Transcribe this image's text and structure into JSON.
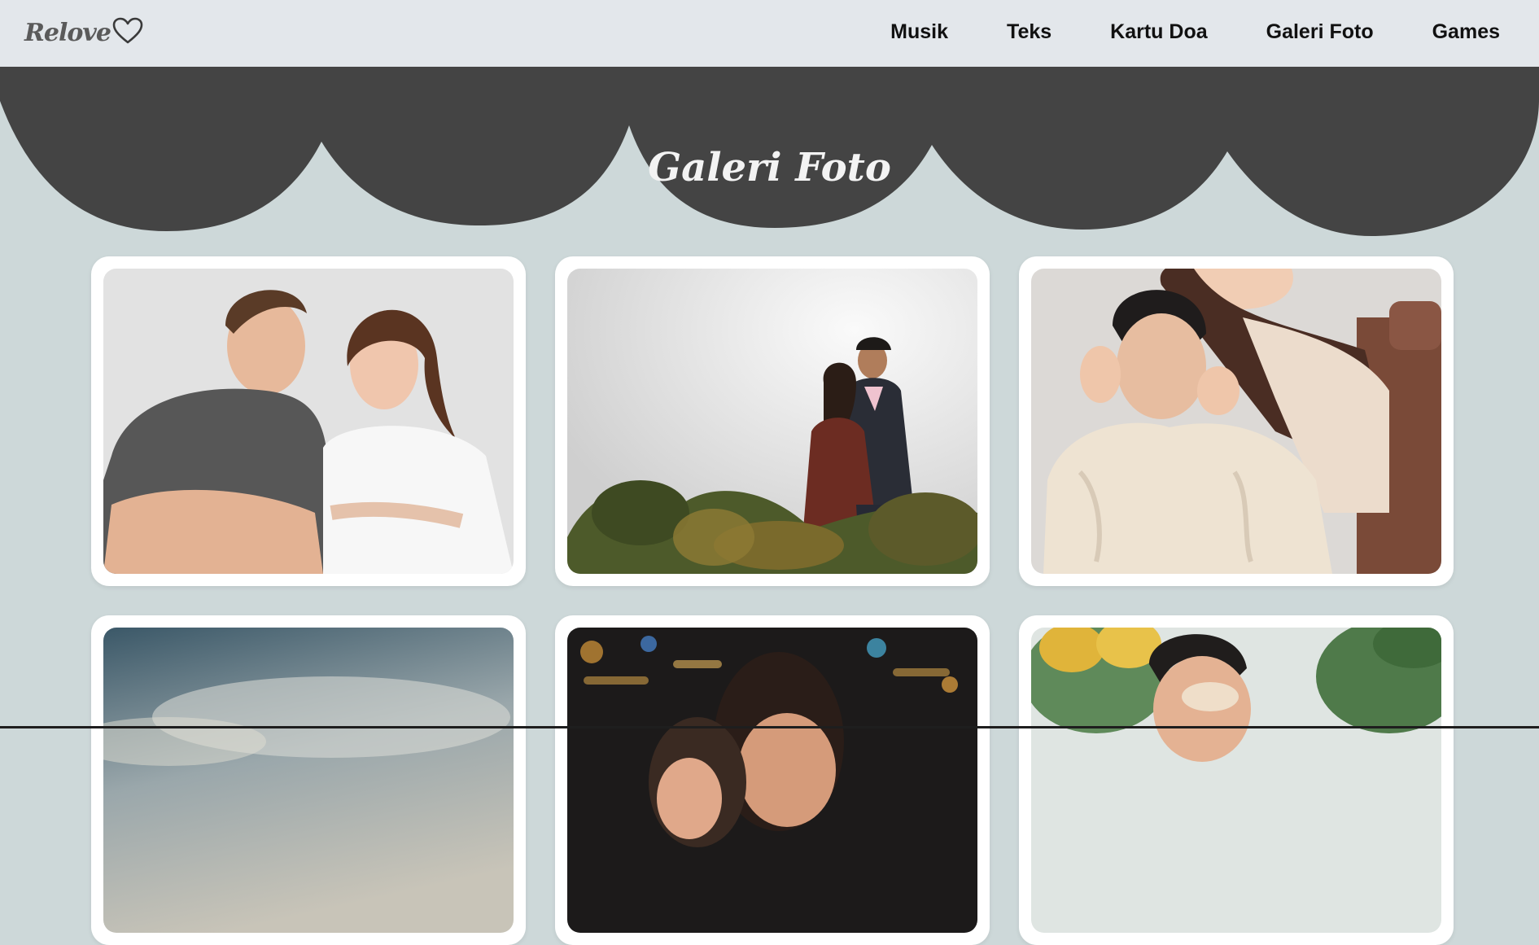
{
  "nav": {
    "brand": "Relove",
    "brand_icon": "heart-outline-icon",
    "links": [
      "Musik",
      "Teks",
      "Kartu Doa",
      "Galeri Foto",
      "Games"
    ]
  },
  "page": {
    "title": "Galeri Foto"
  },
  "colors": {
    "navbar_bg": "#e3e7eb",
    "page_bg": "#cdd8d9",
    "scallop": "#444444",
    "card_bg": "#ffffff"
  },
  "gallery": {
    "photos": [
      {
        "subject": "couple-smiling-portrait"
      },
      {
        "subject": "couple-outdoor-kiss-forehead"
      },
      {
        "subject": "couple-embrace-sweater"
      },
      {
        "subject": "sky-landscape"
      },
      {
        "subject": "couple-city-lights"
      },
      {
        "subject": "couple-park-smiling"
      }
    ]
  }
}
